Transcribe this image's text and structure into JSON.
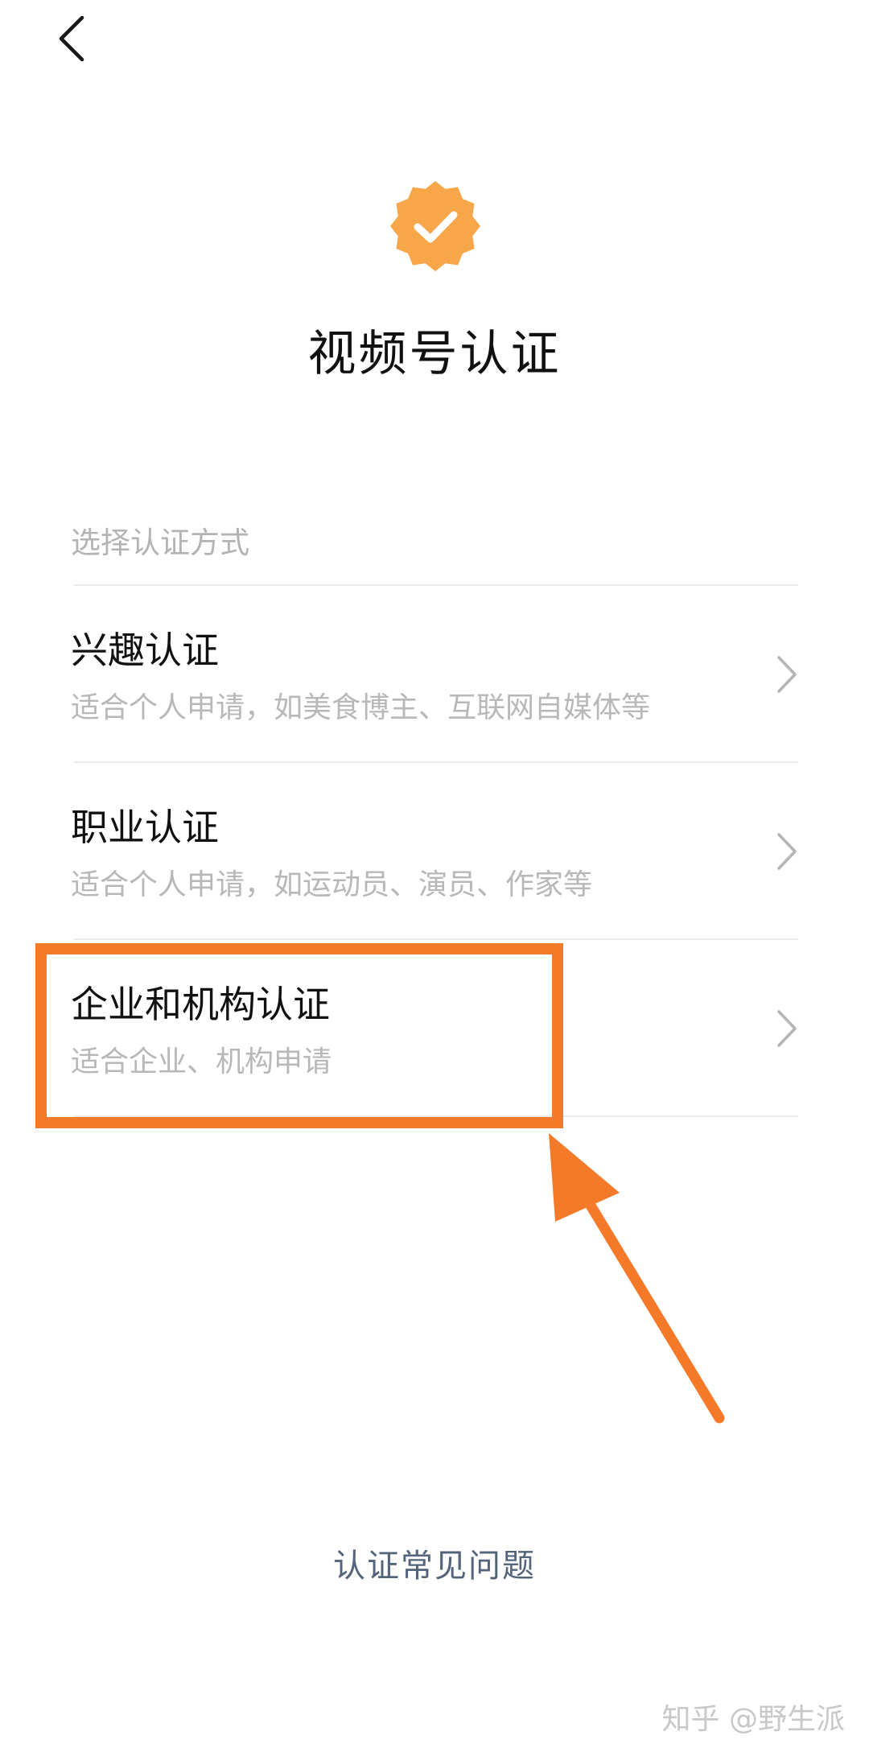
{
  "header": {
    "back_icon": "chevron-left-icon",
    "badge_icon": "verified-badge-icon",
    "badge_color": "#f7a64a",
    "title": "视频号认证"
  },
  "section": {
    "label": "选择认证方式"
  },
  "options": [
    {
      "title": "兴趣认证",
      "desc": "适合个人申请，如美食博主、互联网自媒体等"
    },
    {
      "title": "职业认证",
      "desc": "适合个人申请，如运动员、演员、作家等"
    },
    {
      "title": "企业和机构认证",
      "desc": "适合企业、机构申请"
    }
  ],
  "annotation": {
    "color": "#f47a2a"
  },
  "footer": {
    "faq_label": "认证常见问题",
    "watermark": "知乎 @野生派"
  }
}
